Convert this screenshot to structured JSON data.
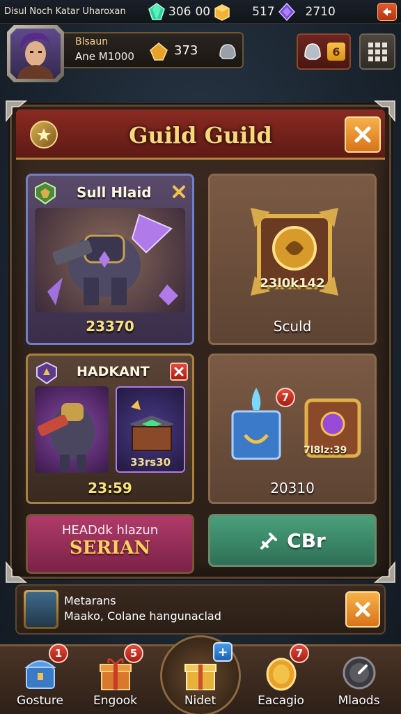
{
  "topbar": {
    "title": "Disul Noch Katar Uharoxan",
    "resources": [
      {
        "icon": "green-gem-icon",
        "value": "306"
      },
      {
        "icon": "gold-crate-icon",
        "value": "00"
      },
      {
        "icon": "purple-gem-icon",
        "value": "517"
      },
      {
        "icon": "orange-exit-icon",
        "value": "2710"
      }
    ]
  },
  "profile": {
    "name": "Blsaun",
    "subtitle": "Ane M1000",
    "amount": "373",
    "chest_count": "6"
  },
  "panel": {
    "title": "Guild Guild"
  },
  "cards": {
    "a": {
      "title": "Sull Hlaid",
      "value": "23370"
    },
    "b": {
      "code": "23l0k142",
      "label": "Sculd"
    },
    "c": {
      "title": "HADKANT",
      "code": "33rs30",
      "value": "23:59"
    },
    "d": {
      "badge": "7",
      "code": "7l8lz:39",
      "value": "20310"
    }
  },
  "actions": {
    "left_line1": "HEADdk hlazun",
    "left_line2": "SERIAN",
    "right_label": "CBr"
  },
  "notice": {
    "name": "Metarans",
    "message": "Maako, Colane hangunaclad"
  },
  "bottomnav": [
    {
      "label": "Gosture",
      "badge": "1",
      "icon": "blue-chest-icon"
    },
    {
      "label": "Engook",
      "badge": "5",
      "icon": "gift-box-icon"
    },
    {
      "label": "Nidet",
      "badge": "+",
      "icon": "gold-gift-icon"
    },
    {
      "label": "Eacagio",
      "badge": "7",
      "icon": "gold-coin-icon"
    },
    {
      "label": "Mlaods",
      "badge": "",
      "icon": "dial-icon"
    }
  ],
  "colors": {
    "panel_header": "#8a2a22",
    "title_gold": "#f9d87d",
    "accent_orange": "#d8731a",
    "green_action": "#4aa07a",
    "pink_action": "#b03a68"
  }
}
